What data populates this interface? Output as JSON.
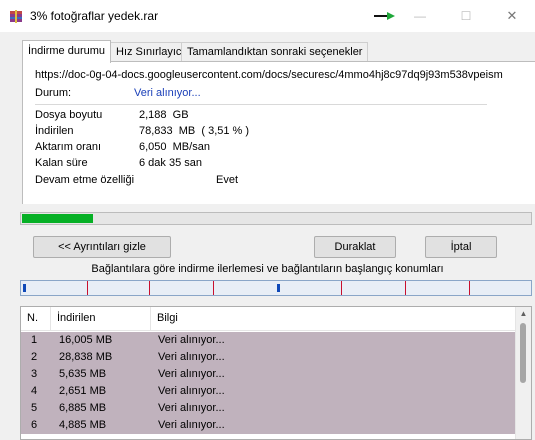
{
  "window": {
    "title": "3% fotoğraflar yedek.rar",
    "minimize_label": "—",
    "maximize_label": "☐",
    "close_label": "✕"
  },
  "tabs": [
    {
      "label": "İndirme durumu",
      "active": true
    },
    {
      "label": "Hız Sınırlayıcı",
      "active": false
    },
    {
      "label": "Tamamlandıktan sonraki seçenekler",
      "active": false
    }
  ],
  "download": {
    "url": "https://doc-0g-04-docs.googleusercontent.com/docs/securesc/4mmo4hj8c97dq9j93m538vpeism",
    "status_label": "Durum:",
    "status_value": "Veri alınıyor...",
    "rows": [
      {
        "label": "Dosya boyutu",
        "value": "2,188  GB"
      },
      {
        "label": "İndirilen",
        "value": "78,833  MB  ( 3,51 % )"
      },
      {
        "label": "Aktarım oranı",
        "value": "6,050  MB/san"
      },
      {
        "label": "Kalan süre",
        "value": "6 dak 35 san"
      },
      {
        "label": "Devam etme özelliği",
        "value": "Evet"
      }
    ],
    "progress_fraction": 0.0351
  },
  "buttons": {
    "details": "<< Ayrıntıları gizle",
    "pause": "Duraklat",
    "cancel": "İptal"
  },
  "connections": {
    "caption": "Bağlantılara göre indirme ilerlemesi ve bağlantıların başlangıç konumları"
  },
  "table": {
    "headers": [
      "N.",
      "İndirilen",
      "Bilgi"
    ],
    "rows": [
      {
        "n": "1",
        "downloaded": "16,005  MB",
        "info": "Veri alınıyor..."
      },
      {
        "n": "2",
        "downloaded": "28,838  MB",
        "info": "Veri alınıyor..."
      },
      {
        "n": "3",
        "downloaded": "5,635  MB",
        "info": "Veri alınıyor..."
      },
      {
        "n": "4",
        "downloaded": "2,651  MB",
        "info": "Veri alınıyor..."
      },
      {
        "n": "5",
        "downloaded": "6,885  MB",
        "info": "Veri alınıyor..."
      },
      {
        "n": "6",
        "downloaded": "4,885  MB",
        "info": "Veri alınıyor..."
      }
    ]
  },
  "colors": {
    "progress": "#06b025",
    "row_highlight": "#c0b2bd",
    "status_link": "#1a3fb8",
    "connection_marker": "#c8102e",
    "connection_segment": "#0f49b8"
  },
  "icons": [
    "rar-archive-icon",
    "green-arrow-icon",
    "scroll-up-icon"
  ]
}
